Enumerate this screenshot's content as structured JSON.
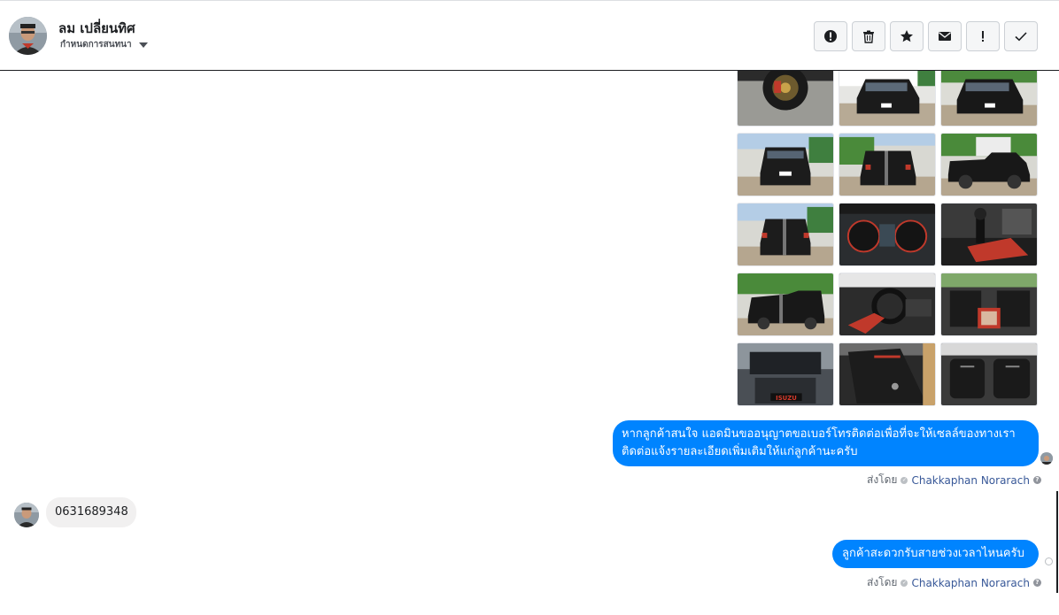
{
  "header": {
    "contact_name": "ลม เปลี่ยนทิศ",
    "label_dropdown": "กำหนดการสนทนา",
    "actions": [
      {
        "name": "spam-icon",
        "title": "Mark as spam"
      },
      {
        "name": "trash-icon",
        "title": "Delete"
      },
      {
        "name": "star-icon",
        "title": "Star"
      },
      {
        "name": "envelope-icon",
        "title": "Mark as unread"
      },
      {
        "name": "exclamation-icon",
        "title": "Follow up"
      },
      {
        "name": "check-icon",
        "title": "Mark as done"
      }
    ]
  },
  "messages": {
    "photo_count": 15,
    "reply_1_line_1": "หากลูกค้าสนใจ แอดมินขออนุญาตขอเบอร์โทรติดต่อเพื่อที่จะให้เซลล์ของทางเรา",
    "reply_1_line_2": "ติดต่อแจ้งรายละเอียดเพิ่มเติมให้แก่ลูกค้านะครับ",
    "sent_by_prefix": "ส่งโดย",
    "sent_by_name": "Chakkaphan Norarach",
    "customer_message": "0631689348",
    "reply_2": "ลูกค้าสะดวกรับสายช่วงเวลาไหนครับ"
  },
  "colors": {
    "bubble_outgoing": "#0084ff",
    "bubble_incoming": "#f1f0f0",
    "link_name": "#385898"
  }
}
